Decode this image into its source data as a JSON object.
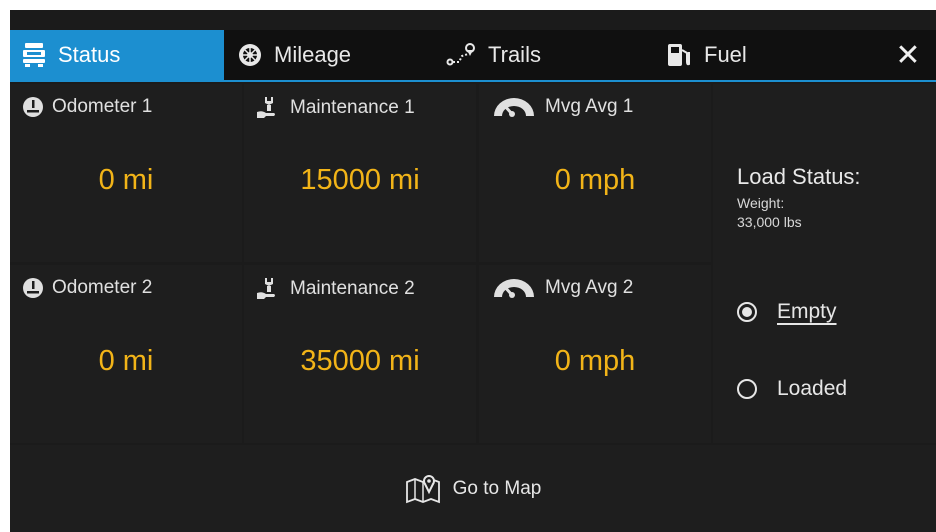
{
  "tabs": {
    "status": "Status",
    "mileage": "Mileage",
    "trails": "Trails",
    "fuel": "Fuel",
    "active": "Status"
  },
  "close_label": "✕",
  "tiles": [
    {
      "label": "Odometer 1",
      "value": "0 mi",
      "icon": "odometer-icon"
    },
    {
      "label": "Maintenance 1",
      "value": "15000 mi",
      "icon": "maintenance-icon"
    },
    {
      "label": "Mvg Avg 1",
      "value": "0 mph",
      "icon": "speedometer-icon"
    },
    {
      "label": "Odometer 2",
      "value": "0 mi",
      "icon": "odometer-icon"
    },
    {
      "label": "Maintenance 2",
      "value": "35000 mi",
      "icon": "maintenance-icon"
    },
    {
      "label": "Mvg Avg 2",
      "value": "0 mph",
      "icon": "speedometer-icon"
    }
  ],
  "load": {
    "title": "Load Status:",
    "weight_label": "Weight:",
    "weight_value": "33,000 lbs",
    "options": [
      {
        "label": "Empty",
        "selected": true
      },
      {
        "label": "Loaded",
        "selected": false
      }
    ]
  },
  "map_button": "Go to Map",
  "colors": {
    "accent": "#1c8fd0",
    "value": "#f2b418",
    "background": "#1b1b1b"
  }
}
